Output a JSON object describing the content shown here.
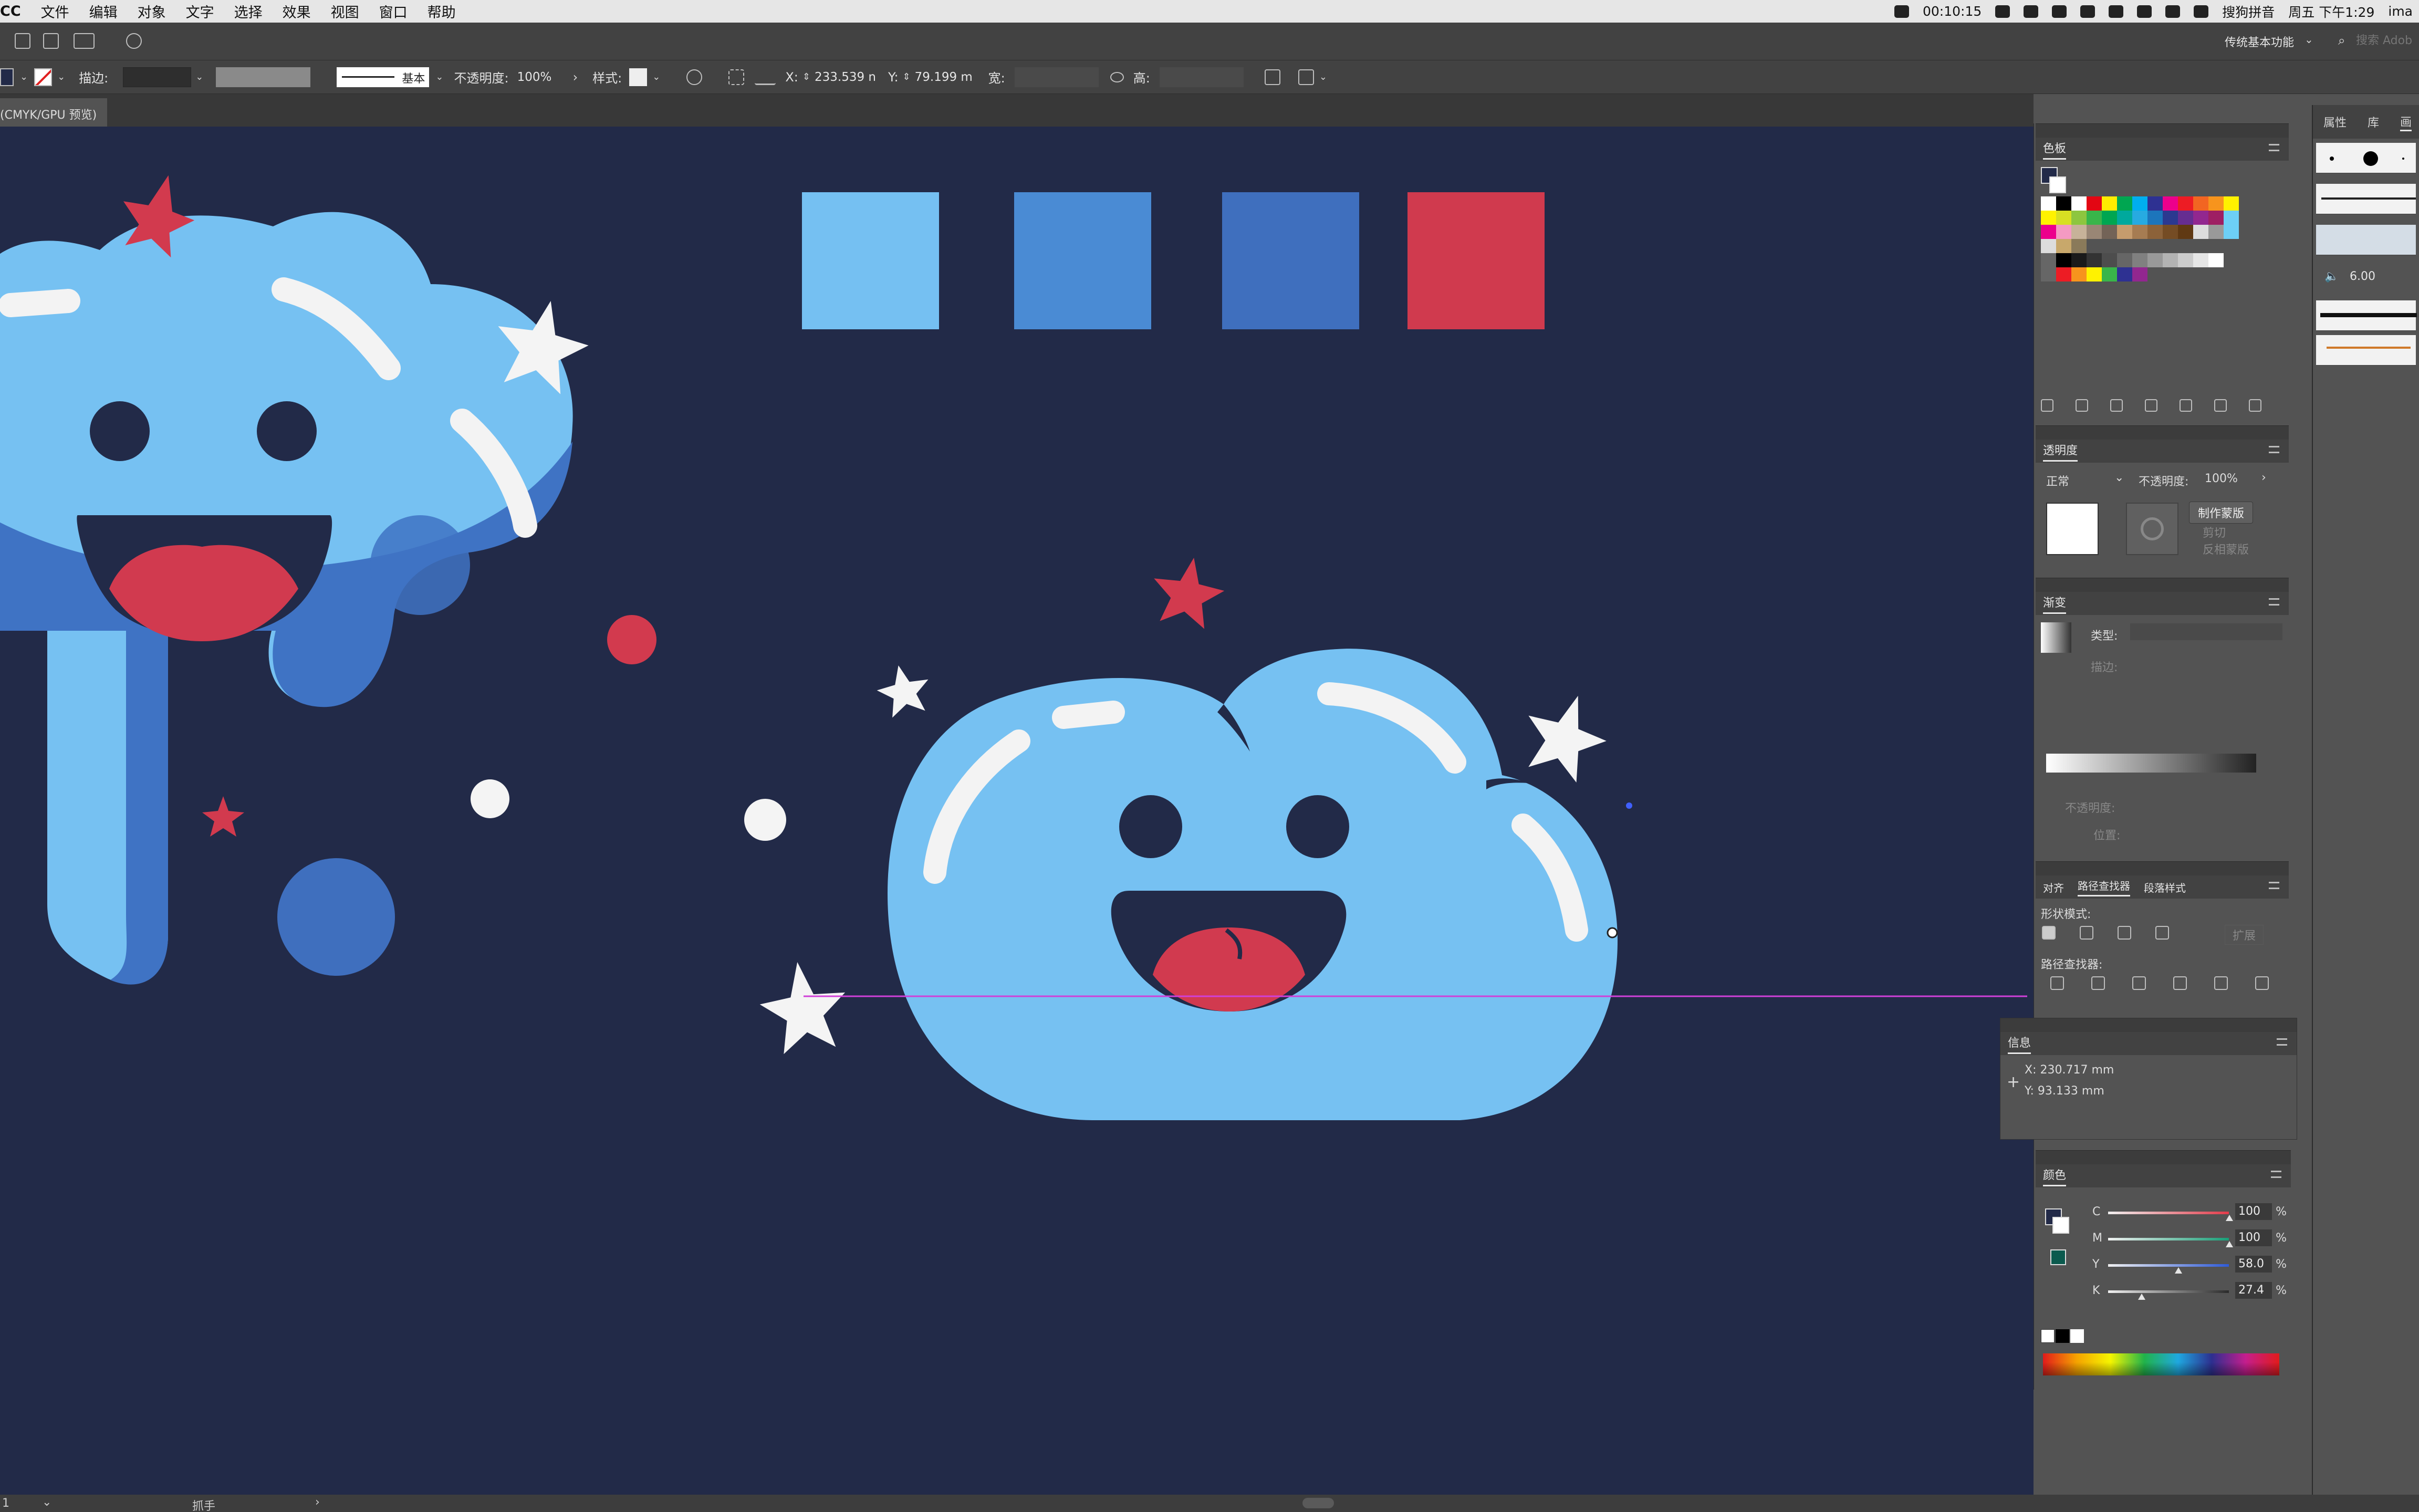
{
  "menubar": {
    "app": "CC",
    "items": [
      "文件",
      "编辑",
      "对象",
      "文字",
      "选择",
      "效果",
      "视图",
      "窗口",
      "帮助"
    ],
    "record_time": "00:10:15",
    "ime": "搜狗拼音",
    "clock": "周五 下午1:29",
    "user": "ima"
  },
  "approw": {
    "workspace": "传统基本功能",
    "search_placeholder": "搜索 Adob"
  },
  "ctrlbar": {
    "stroke_label": "描边:",
    "stroke_style": "基本",
    "opacity_label": "不透明度:",
    "opacity_value": "100%",
    "style_label": "样式:",
    "x_label": "X:",
    "x_value": "233.539 n",
    "y_label": "Y:",
    "y_value": "79.199 m",
    "w_label": "宽:",
    "h_label": "高:"
  },
  "doc_tab": {
    "label": "(CMYK/GPU 预览)"
  },
  "statusbar": {
    "zoom": "1",
    "tool": "抓手"
  },
  "panels": {
    "swatches": {
      "title": "色板"
    },
    "transparency": {
      "title": "透明度",
      "blend_mode": "正常",
      "opacity_label": "不透明度:",
      "opacity_value": "100%",
      "make_mask": "制作蒙版",
      "clip": "剪切",
      "invert_mask": "反相蒙版"
    },
    "gradient": {
      "title": "渐变",
      "type_label": "类型:",
      "stroke_label": "描边:",
      "opacity_label": "不透明度:",
      "position_label": "位置:"
    },
    "pathfinder": {
      "tabs": [
        "对齐",
        "路径查找器",
        "段落样式"
      ],
      "shape_modes": "形状模式:",
      "expand": "扩展",
      "pathfinders": "路径查找器:"
    },
    "info": {
      "title": "信息",
      "x": "X:  230.717 mm",
      "y": "Y:  93.133 mm"
    },
    "color": {
      "title": "颜色",
      "channels": [
        {
          "label": "C",
          "value": "100",
          "color": "#e23b4a",
          "level": 1.0
        },
        {
          "label": "M",
          "value": "100",
          "color": "#18a078",
          "level": 1.0
        },
        {
          "label": "Y",
          "value": "58.0",
          "color": "#2f5bd8",
          "level": 0.58
        },
        {
          "label": "K",
          "value": "27.4",
          "color": "#2b2b2b",
          "level": 0.274
        }
      ],
      "pct": "%"
    }
  },
  "farright": {
    "tabs": [
      "属性",
      "库",
      "画"
    ],
    "brush_size": "6.00"
  },
  "canvas_colors": {
    "background": "#222a48",
    "swatch_light": "#75c0f2",
    "swatch_mid": "#4a8bd4",
    "swatch_dark": "#3f6fbe",
    "swatch_red": "#d03a4e",
    "cloud_light": "#76c1f2",
    "cloud_dark": "#3f73c4",
    "mouth": "#222a48",
    "tongue": "#d13a4f",
    "highlight": "#f3f3f3",
    "star_red": "#d23a4e",
    "star_white": "#f4f4f4",
    "guide": "#d040d8"
  }
}
